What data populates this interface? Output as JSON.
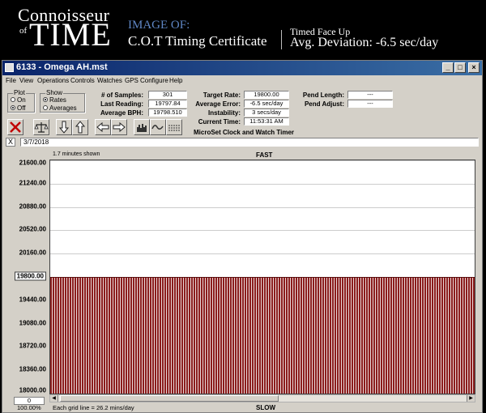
{
  "banner": {
    "logo_top": "Connoisseur",
    "logo_of": "of",
    "logo_time": "TIME",
    "image_of": "IMAGE OF:",
    "certificate": "C.O.T Timing Certificate",
    "position": "Timed Face Up",
    "avg_deviation": "Avg. Deviation: -6.5 sec/day"
  },
  "window": {
    "title": "6133 - Omega AH.mst",
    "menu": [
      "File",
      "View",
      "Operations",
      "Controls",
      "Watches",
      "GPS",
      "Configure",
      "Help"
    ]
  },
  "plot_group": {
    "label": "Plot",
    "options": [
      "On",
      "Off"
    ],
    "selected": "Off"
  },
  "show_group": {
    "label": "Show",
    "options": [
      "Rates",
      "Averages"
    ],
    "selected": "Rates"
  },
  "stats": {
    "samples_label": "# of Samples:",
    "samples": "301",
    "last_label": "Last Reading:",
    "last": "19797.84",
    "avgbph_label": "Average BPH:",
    "avgbph": "19798.510",
    "target_label": "Target Rate:",
    "target": "19800.00",
    "avgerr_label": "Average Error:",
    "avgerr": "-6.5 sec/day",
    "instab_label": "Instability:",
    "instab": "3 secs/day",
    "time_label": "Current Time:",
    "time": "11:53:31 AM",
    "pendlen_label": "Pend Length:",
    "pendlen": "---",
    "pendadj_label": "Pend Adjust:",
    "pendadj": "---"
  },
  "microset": "MicroSet Clock and Watch Timer",
  "date": "3/7/2018",
  "date_x": "X",
  "chart_data": {
    "type": "bar",
    "minutes_shown": "1.7 minutes shown",
    "top_label": "FAST",
    "bottom_label": "SLOW",
    "yticks": [
      "21600.00",
      "21240.00",
      "20880.00",
      "20520.00",
      "20160.00",
      "19800.00",
      "19440.00",
      "19080.00",
      "18720.00",
      "18360.00",
      "18000.00"
    ],
    "ylim": [
      18000,
      21600
    ],
    "target": 19800,
    "bar_value": 19797.84,
    "samples": 301,
    "grid_note": "Each grid line = 26.2 mins/day",
    "zoom": "100.00%",
    "scroll_value": "0"
  },
  "colors": {
    "bar": "#8b1c1c",
    "title_bar": "#0a246a",
    "image_of": "#5f86c4"
  }
}
